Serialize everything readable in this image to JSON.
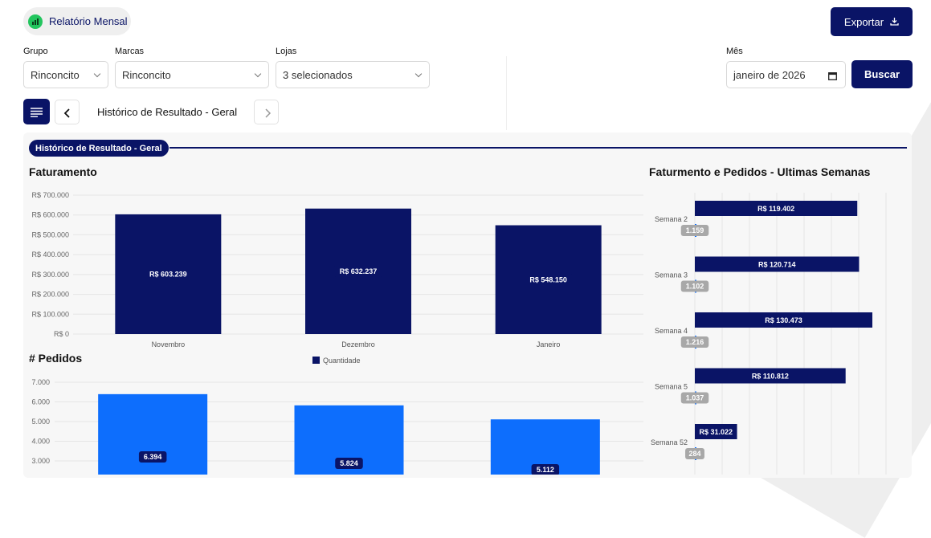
{
  "header": {
    "report_label": "Relatório Mensal",
    "export_label": "Exportar"
  },
  "filters": {
    "grupo": {
      "label": "Grupo",
      "value": "Rinconcito"
    },
    "marcas": {
      "label": "Marcas",
      "value": "Rinconcito"
    },
    "lojas": {
      "label": "Lojas",
      "value": "3 selecionados"
    },
    "mes": {
      "label": "Mês",
      "value": "janeiro de 2026"
    },
    "search_label": "Buscar"
  },
  "nav": {
    "title": "Histórico de Resultado - Geral"
  },
  "section": {
    "pill": "Histórico de Resultado - Geral"
  },
  "colors": {
    "navy": "#0a1466",
    "blue": "#0d6efd",
    "gray": "#a8a8a8"
  },
  "chart_data": [
    {
      "type": "bar",
      "title": "Faturamento",
      "categories": [
        "Novembro",
        "Dezembro",
        "Janeiro"
      ],
      "values": [
        603239,
        632237,
        548150
      ],
      "value_labels": [
        "R$ 603.239",
        "R$ 632.237",
        "R$ 548.150"
      ],
      "ylim": [
        0,
        700000
      ],
      "yticks": [
        "R$ 700.000",
        "R$ 600.000",
        "R$ 500.000",
        "R$ 400.000",
        "R$ 300.000",
        "R$ 200.000",
        "R$ 100.000",
        "R$ 0"
      ],
      "grid": true
    },
    {
      "type": "bar",
      "title": "# Pedidos",
      "legend": "Quantidade",
      "categories": [
        "Novembro",
        "Dezembro",
        "Janeiro"
      ],
      "values": [
        6394,
        5824,
        5112
      ],
      "value_labels": [
        "6.394",
        "5.824",
        "5.112"
      ],
      "yticks": [
        "7.000",
        "6.000",
        "5.000",
        "4.000",
        "3.000"
      ],
      "grid": true
    },
    {
      "type": "bar",
      "orientation": "horizontal",
      "title": "Faturmento e Pedidos - Ultimas Semanas",
      "categories": [
        "Semana 2",
        "Semana 3",
        "Semana 4",
        "Semana 5",
        "Semana 52"
      ],
      "series": [
        {
          "values": [
            119402,
            120714,
            130473,
            110812,
            31022
          ],
          "labels": [
            "R$ 119.402",
            "R$ 120.714",
            "R$ 130.473",
            "R$ 110.812",
            "R$ 31.022"
          ]
        },
        {
          "values": [
            1159,
            1102,
            1216,
            1037,
            284
          ],
          "labels": [
            "1.159",
            "1.102",
            "1.216",
            "1.037",
            "284"
          ]
        }
      ]
    }
  ]
}
